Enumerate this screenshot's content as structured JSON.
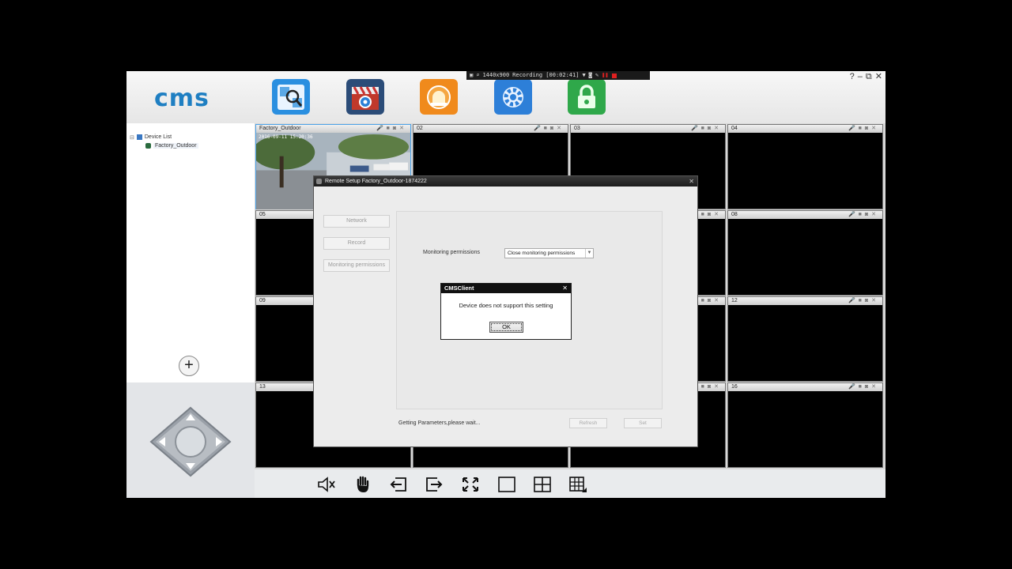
{
  "recording_bar": {
    "resolution": "1440x900",
    "status": "Recording [00:02:41]"
  },
  "header": {
    "logo": "cms",
    "window_controls": [
      "?",
      "–",
      "⧉",
      "✕"
    ]
  },
  "sidebar": {
    "tree_root": "Device List",
    "tree_child": "Factory_Outdoor",
    "add_label": "+"
  },
  "grid": {
    "cells": [
      {
        "label": "Factory_Outdoor",
        "active": true
      },
      {
        "label": "02"
      },
      {
        "label": "03"
      },
      {
        "label": "04"
      },
      {
        "label": "05"
      },
      {
        "label": ""
      },
      {
        "label": ""
      },
      {
        "label": "08"
      },
      {
        "label": "09"
      },
      {
        "label": ""
      },
      {
        "label": ""
      },
      {
        "label": "12"
      },
      {
        "label": "13"
      },
      {
        "label": ""
      },
      {
        "label": ""
      },
      {
        "label": "16"
      }
    ],
    "timestamp": "2016-09-11  15:20:36"
  },
  "remote_setup": {
    "title": "Remote Setup Factory_Outdoor-1874222",
    "nav": [
      "Network",
      "Record",
      "Monitoring permissions"
    ],
    "perm_label": "Monitoring permissions",
    "perm_value": "Close monitoring permissions",
    "status": "Getting Parameters,please wait...",
    "refresh": "Refresh",
    "set": "Set"
  },
  "message_box": {
    "title": "CMSClient",
    "text": "Device does not support this setting",
    "ok": "OK"
  },
  "colors": {
    "accent": "#1f7fc2",
    "active_border": "#4da3e8"
  }
}
